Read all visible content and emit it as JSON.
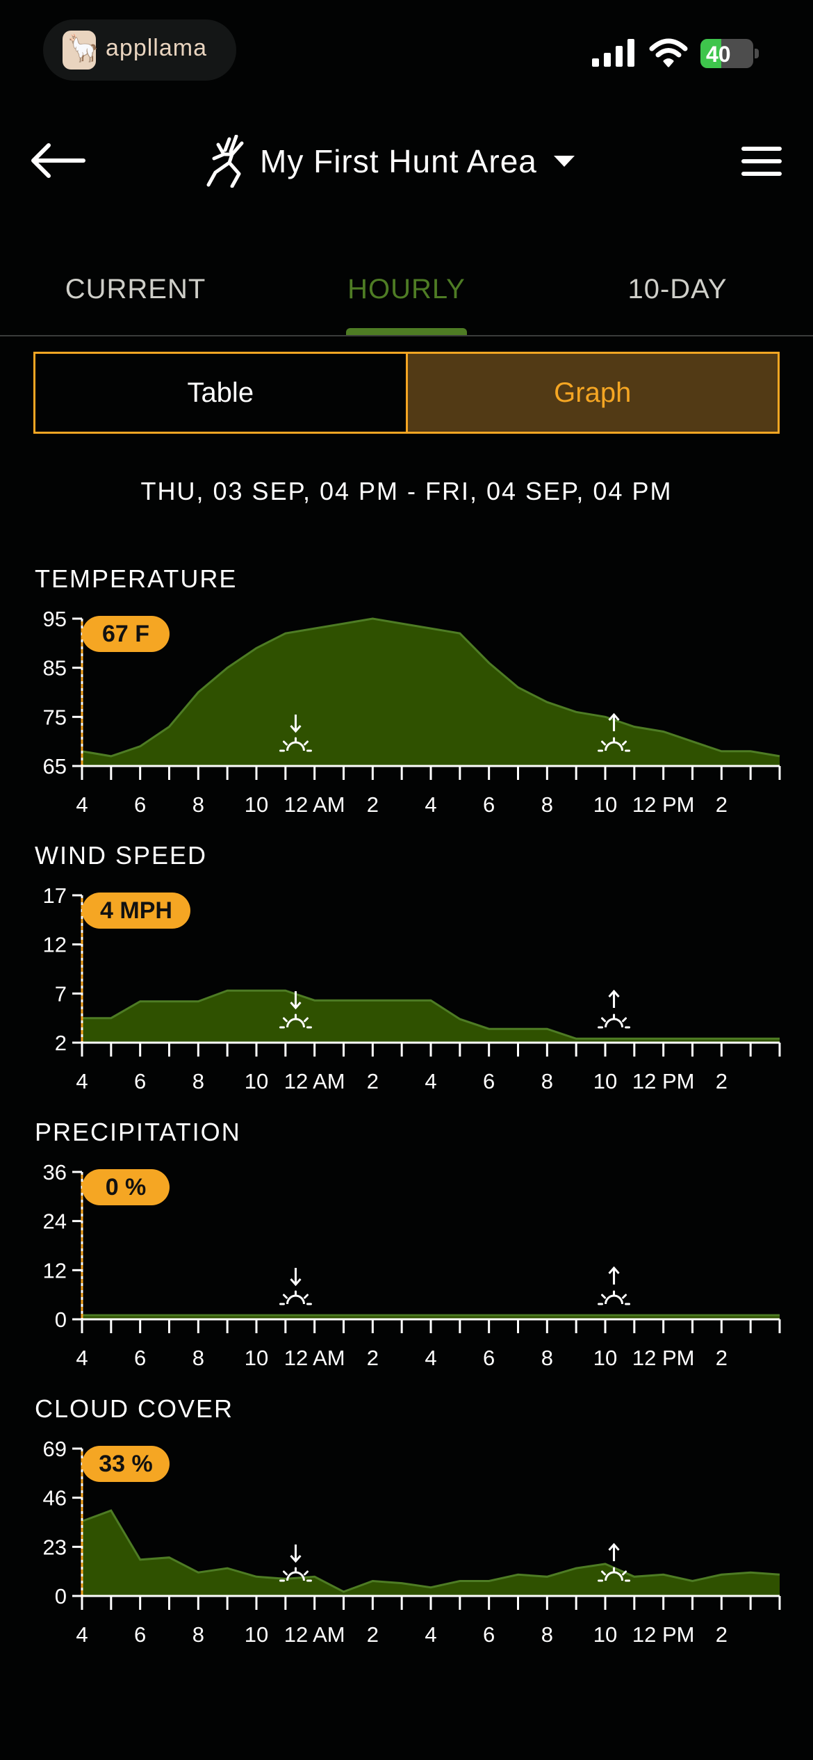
{
  "status_bar": {
    "app_name": "appllama",
    "battery": "40",
    "battery_level": 0.4,
    "icons": [
      "cellular-signal-icon",
      "wifi-icon",
      "battery-charging-icon"
    ]
  },
  "header": {
    "area_title": "My First Hunt Area",
    "icons": [
      "back-arrow-icon",
      "deer-logo-icon",
      "dropdown-caret-icon",
      "hamburger-menu-icon"
    ]
  },
  "tabs": {
    "items": [
      "CURRENT",
      "HOURLY",
      "10-DAY"
    ],
    "active": "HOURLY"
  },
  "view_toggle": {
    "table": "Table",
    "graph": "Graph",
    "active": "Graph"
  },
  "date_range": "THU, 03 SEP, 04 PM - FRI, 04 SEP, 04 PM",
  "colors": {
    "accent": "#f5a623",
    "green": "#4e7c24",
    "area_fill": "#2f5100",
    "area_line": "#4e7c24",
    "background": "#020303"
  },
  "chart_data": [
    {
      "type": "area",
      "title": "TEMPERATURE",
      "badge": "67 F",
      "ylim": [
        65,
        95
      ],
      "yticks": [
        "95",
        "85",
        "75",
        "65"
      ],
      "x": [
        "4",
        "5",
        "6",
        "7",
        "8",
        "9",
        "10",
        "11",
        "12 AM",
        "1",
        "2",
        "3",
        "4",
        "5",
        "6",
        "7",
        "8",
        "9",
        "10",
        "11",
        "12 PM",
        "1",
        "2",
        "3",
        "4"
      ],
      "xtick_labels": [
        "4",
        "6",
        "8",
        "10",
        "12 AM",
        "2",
        "4",
        "6",
        "8",
        "10",
        "12 PM",
        "2"
      ],
      "values": [
        68,
        67,
        69,
        73,
        80,
        85,
        89,
        92,
        93,
        94,
        95,
        94,
        93,
        92,
        86,
        81,
        78,
        76,
        75,
        73,
        72,
        70,
        68,
        68,
        67
      ],
      "sunset_hour": 7.35,
      "sunrise_hour": 18.3
    },
    {
      "type": "area",
      "title": "WIND SPEED",
      "badge": "4 MPH",
      "ylim": [
        2,
        17
      ],
      "yticks": [
        "17",
        "12",
        "7",
        "2"
      ],
      "x": [
        "4",
        "5",
        "6",
        "7",
        "8",
        "9",
        "10",
        "11",
        "12 AM",
        "1",
        "2",
        "3",
        "4",
        "5",
        "6",
        "7",
        "8",
        "9",
        "10",
        "11",
        "12 PM",
        "1",
        "2",
        "3",
        "4"
      ],
      "xtick_labels": [
        "4",
        "6",
        "8",
        "10",
        "12 AM",
        "2",
        "4",
        "6",
        "8",
        "10",
        "12 PM",
        "2"
      ],
      "values": [
        4.5,
        4.5,
        6.2,
        6.2,
        6.2,
        7.3,
        7.3,
        7.3,
        6.3,
        6.3,
        6.3,
        6.3,
        6.3,
        4.4,
        3.4,
        3.4,
        3.4,
        2.4,
        2.4,
        2.4,
        2.4,
        2.4,
        2.4,
        2.4,
        2.4
      ],
      "sunset_hour": 7.35,
      "sunrise_hour": 18.3
    },
    {
      "type": "area",
      "title": "PRECIPITATION",
      "badge": "0 %",
      "ylim": [
        0,
        36
      ],
      "yticks": [
        "36",
        "24",
        "12",
        "0"
      ],
      "x": [
        "4",
        "5",
        "6",
        "7",
        "8",
        "9",
        "10",
        "11",
        "12 AM",
        "1",
        "2",
        "3",
        "4",
        "5",
        "6",
        "7",
        "8",
        "9",
        "10",
        "11",
        "12 PM",
        "1",
        "2",
        "3",
        "4"
      ],
      "xtick_labels": [
        "4",
        "6",
        "8",
        "10",
        "12 AM",
        "2",
        "4",
        "6",
        "8",
        "10",
        "12 PM",
        "2"
      ],
      "values": [
        1,
        1,
        1,
        1,
        1,
        1,
        1,
        1,
        1,
        1,
        1,
        1,
        1,
        1,
        1,
        1,
        1,
        1,
        1,
        1,
        1,
        1,
        1,
        1,
        1
      ],
      "sunset_hour": 7.35,
      "sunrise_hour": 18.3
    },
    {
      "type": "area",
      "title": "CLOUD COVER",
      "badge": "33 %",
      "ylim": [
        0,
        69
      ],
      "yticks": [
        "69",
        "46",
        "23",
        "0"
      ],
      "x": [
        "4",
        "5",
        "6",
        "7",
        "8",
        "9",
        "10",
        "11",
        "12 AM",
        "1",
        "2",
        "3",
        "4",
        "5",
        "6",
        "7",
        "8",
        "9",
        "10",
        "11",
        "12 PM",
        "1",
        "2",
        "3",
        "4"
      ],
      "xtick_labels": [
        "4",
        "6",
        "8",
        "10",
        "12 AM",
        "2",
        "4",
        "6",
        "8",
        "10",
        "12 PM",
        "2"
      ],
      "values": [
        35,
        40,
        17,
        18,
        11,
        13,
        9,
        8,
        9,
        2,
        7,
        6,
        4,
        7,
        7,
        10,
        9,
        13,
        15,
        9,
        10,
        7,
        10,
        11,
        10
      ],
      "sunset_hour": 7.35,
      "sunrise_hour": 18.3
    }
  ]
}
